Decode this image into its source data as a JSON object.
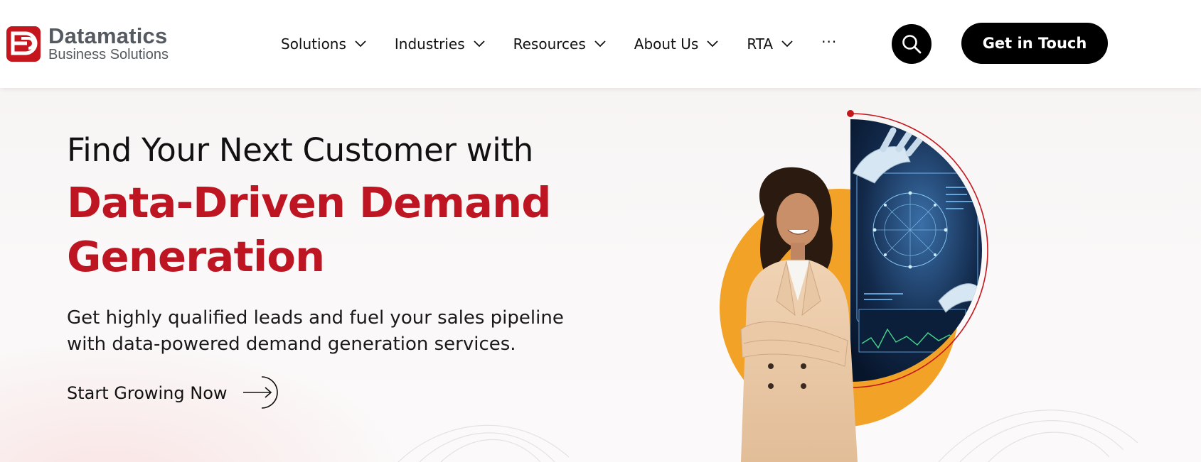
{
  "brand": {
    "name": "Datamatics",
    "subtitle": "Business Solutions",
    "logo_letter": "DB",
    "colors": {
      "accent": "#be1522",
      "orange": "#f2a226",
      "dark": "#000000",
      "logo_gray": "#555a60"
    }
  },
  "nav": {
    "items": [
      {
        "label": "Solutions",
        "icon": "chevron-down-icon"
      },
      {
        "label": "Industries",
        "icon": "chevron-down-icon"
      },
      {
        "label": "Resources",
        "icon": "chevron-down-icon"
      },
      {
        "label": "About Us",
        "icon": "chevron-down-icon"
      },
      {
        "label": "RTA",
        "icon": "chevron-down-icon"
      }
    ],
    "more_label": "···"
  },
  "header": {
    "search_icon": "search-icon",
    "cta_label": "Get in Touch"
  },
  "hero": {
    "kicker": "Find Your Next Customer with",
    "title": "Data-Driven Demand Generation",
    "description": "Get highly qualified leads and fuel your sales pipeline with data-powered demand generation services.",
    "link_label": "Start Growing Now",
    "link_icon": "arrow-right-icon"
  }
}
